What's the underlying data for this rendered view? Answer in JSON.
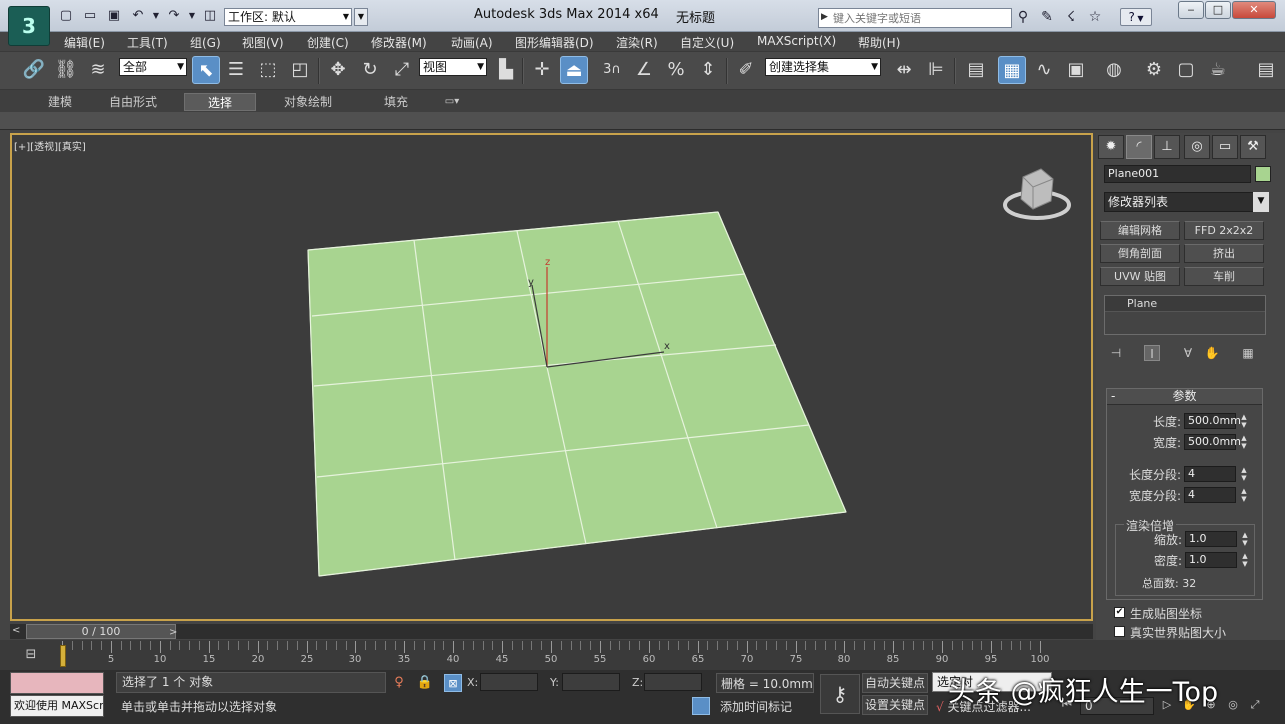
{
  "titlebar": {
    "logo": "3",
    "workspace_label": "工作区: 默认",
    "app_title": "Autodesk 3ds Max  2014 x64",
    "document_title": "无标题",
    "search_placeholder": "键入关键字或短语",
    "help_label": "?",
    "window_buttons": {
      "minimize": "‒",
      "maximize": "□",
      "close": "✕"
    }
  },
  "menu": [
    "编辑(E)",
    "工具(T)",
    "组(G)",
    "视图(V)",
    "创建(C)",
    "修改器(M)",
    "动画(A)",
    "图形编辑器(D)",
    "渲染(R)",
    "自定义(U)",
    "MAXScript(X)",
    "帮助(H)"
  ],
  "toolbar": {
    "selection_filter": "全部",
    "ref_coord": "视图",
    "named_selection": "创建选择集",
    "snap_label": "3"
  },
  "ribbon": {
    "tabs": [
      "建模",
      "自由形式",
      "选择",
      "对象绘制",
      "填充"
    ],
    "selected_tab": "选择"
  },
  "viewport": {
    "label": "[+][透视][真实]",
    "plane_color": "#a8d490",
    "border_color": "#c8a24b",
    "axis": {
      "x": "x",
      "y": "y",
      "z": "z"
    }
  },
  "command_panel": {
    "object_name": "Plane001",
    "object_color": "#a8d490",
    "modifier_list": "修改器列表",
    "modifier_buttons": [
      "编辑网格",
      "FFD 2x2x2",
      "倒角剖面",
      "挤出",
      "UVW 贴图",
      "车削"
    ],
    "stack": [
      "Plane"
    ],
    "rollout_title": "参数",
    "collapse_symbol": "-",
    "params": [
      {
        "label": "长度:",
        "value": "500.0mm"
      },
      {
        "label": "宽度:",
        "value": "500.0mm"
      },
      {
        "label": "长度分段:",
        "value": "4"
      },
      {
        "label": "宽度分段:",
        "value": "4"
      }
    ],
    "render_group": {
      "title": "渲染倍增",
      "scale_label": "缩放:",
      "scale_value": "1.0",
      "density_label": "密度:",
      "density_value": "1.0",
      "total_faces": "总面数: 32"
    },
    "checkboxes": [
      {
        "label": "生成贴图坐标",
        "checked": true
      },
      {
        "label": "真实世界贴图大小",
        "checked": false
      }
    ]
  },
  "timeline": {
    "slider_text": "0 / 100",
    "ticks": [
      "5",
      "10",
      "15",
      "20",
      "25",
      "30",
      "35",
      "40",
      "45",
      "50",
      "55",
      "60",
      "65",
      "70",
      "75",
      "80",
      "85",
      "90",
      "95",
      "100"
    ]
  },
  "status": {
    "maxscript_listener": "欢迎使用 MAXScri",
    "selection": "选择了 1 个 对象",
    "prompt": "单击或单击并拖动以选择对象",
    "x_label": "X:",
    "y_label": "Y:",
    "z_label": "Z:",
    "grid": "栅格 = 10.0mm",
    "add_time_tag": "添加时间标记",
    "auto_key": "自动关键点",
    "set_key": "设置关键点",
    "key_filter": "关键点过滤器...",
    "selected_object": "选定对",
    "current_frame": "0"
  },
  "watermark": "头条 @疯狂人生一Top"
}
